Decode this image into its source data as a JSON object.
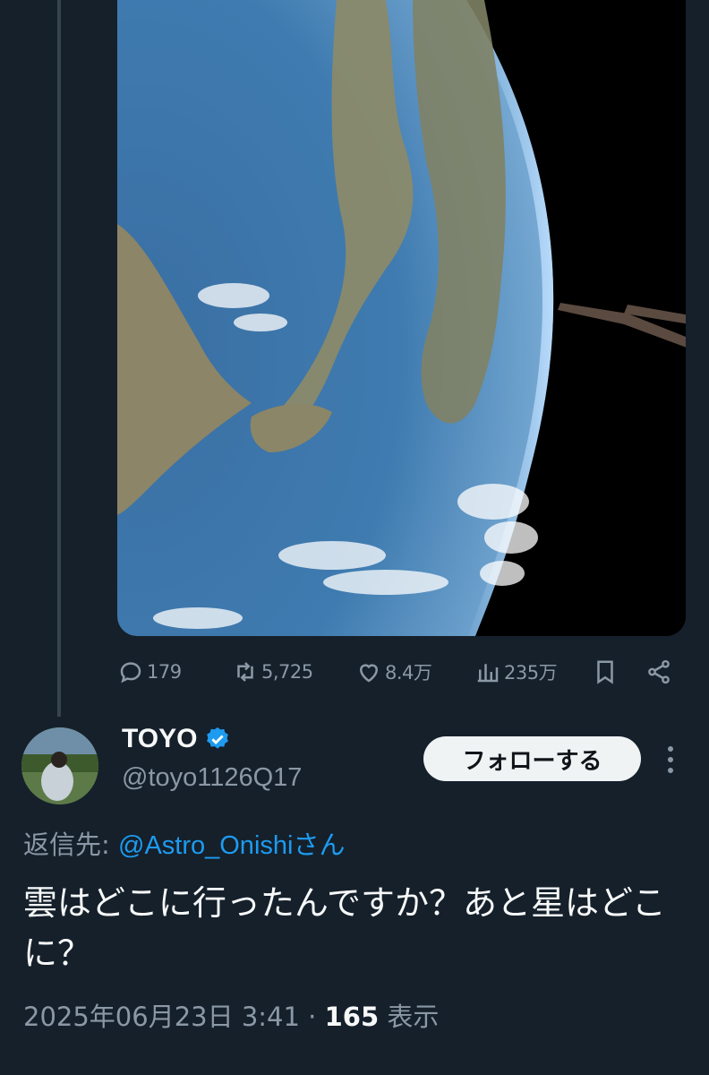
{
  "colors": {
    "background": "#15202b",
    "text_primary": "#f7f9f9",
    "text_secondary": "#8b98a5",
    "accent": "#1d9bf0",
    "follow_button_bg": "#eff3f4"
  },
  "previous_tweet": {
    "media_description_icon": "earth-photo",
    "actions": {
      "reply_count": "179",
      "retweet_count": "5,725",
      "like_count": "8.4万",
      "view_count": "235万"
    }
  },
  "reply": {
    "display_name": "TOYO",
    "verified": true,
    "handle": "@toyo1126Q17",
    "follow_label": "フォローする",
    "replying_to_prefix": "返信先: ",
    "replying_to_mention": "@Astro_Onishi",
    "replying_to_suffix": "さん",
    "text": "雲はどこに行ったんですか？あと星はどこに？",
    "timestamp": "2025年06月23日 3:41 · ",
    "views_number": "165",
    "views_label": " 表示"
  }
}
